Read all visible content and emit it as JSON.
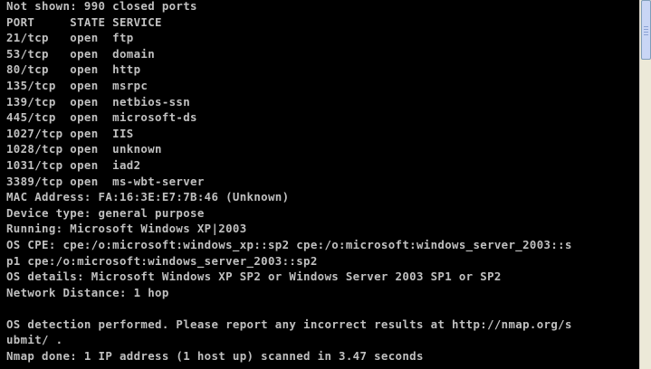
{
  "console": {
    "lines": [
      "Not shown: 990 closed ports",
      "PORT     STATE SERVICE",
      "21/tcp   open  ftp",
      "53/tcp   open  domain",
      "80/tcp   open  http",
      "135/tcp  open  msrpc",
      "139/tcp  open  netbios-ssn",
      "445/tcp  open  microsoft-ds",
      "1027/tcp open  IIS",
      "1028/tcp open  unknown",
      "1031/tcp open  iad2",
      "3389/tcp open  ms-wbt-server",
      "MAC Address: FA:16:3E:E7:7B:46 (Unknown)",
      "Device type: general purpose",
      "Running: Microsoft Windows XP|2003",
      "OS CPE: cpe:/o:microsoft:windows_xp::sp2 cpe:/o:microsoft:windows_server_2003::s",
      "p1 cpe:/o:microsoft:windows_server_2003::sp2",
      "OS details: Microsoft Windows XP SP2 or Windows Server 2003 SP1 or SP2",
      "Network Distance: 1 hop",
      "",
      "OS detection performed. Please report any incorrect results at http://nmap.org/s",
      "ubmit/ .",
      "Nmap done: 1 IP address (1 host up) scanned in 3.47 seconds"
    ]
  },
  "colors": {
    "background": "#000000",
    "text": "#c0c0c0",
    "scrollbar_track": "#ece9d8",
    "scrollbar_thumb": "#c9d6f5"
  }
}
